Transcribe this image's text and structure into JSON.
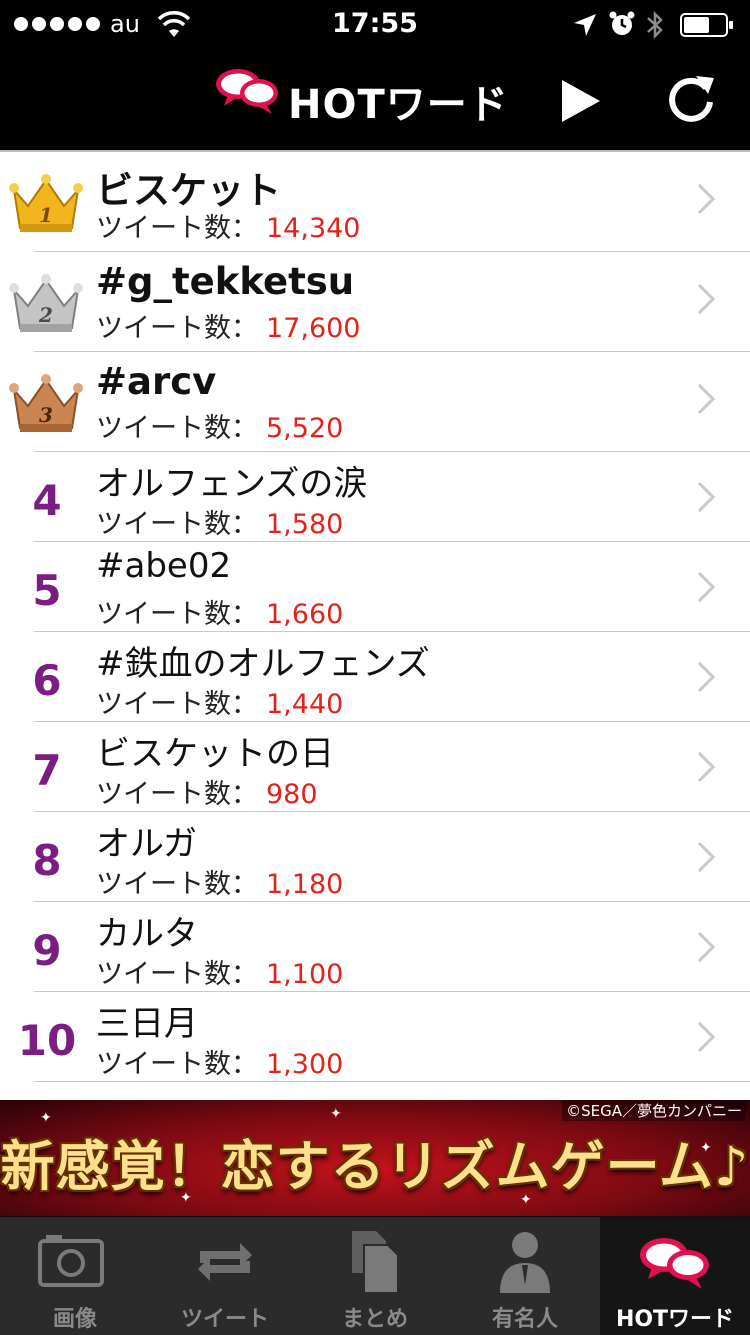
{
  "status_bar": {
    "carrier": "au",
    "time": "17:55",
    "icons": [
      "signal-dots",
      "wifi-icon",
      "location-arrow-icon",
      "alarm-icon",
      "bluetooth-icon",
      "battery-icon"
    ]
  },
  "nav": {
    "title": "HOTワード",
    "logo_icon": "speech-bubbles-icon",
    "play_icon": "play-icon",
    "refresh_icon": "refresh-icon",
    "accent": "#e0114f"
  },
  "ranking": [
    {
      "rank": "1",
      "crown": "gold",
      "word": "ビスケット",
      "count_label": "ツイート数：",
      "count": "14,340"
    },
    {
      "rank": "2",
      "crown": "silver",
      "word": "#g_tekketsu",
      "count_label": "ツイート数：",
      "count": "17,600"
    },
    {
      "rank": "3",
      "crown": "bronze",
      "word": "#arcv",
      "count_label": "ツイート数：",
      "count": "5,520"
    },
    {
      "rank": "4",
      "word": "オルフェンズの涙",
      "count_label": "ツイート数：",
      "count": "1,580"
    },
    {
      "rank": "5",
      "word": "#abe02",
      "count_label": "ツイート数：",
      "count": "1,660"
    },
    {
      "rank": "6",
      "word": "#鉄血のオルフェンズ",
      "count_label": "ツイート数：",
      "count": "1,440"
    },
    {
      "rank": "7",
      "word": "ビスケットの日",
      "count_label": "ツイート数：",
      "count": "980"
    },
    {
      "rank": "8",
      "word": "オルガ",
      "count_label": "ツイート数：",
      "count": "1,180"
    },
    {
      "rank": "9",
      "word": "カルタ",
      "count_label": "ツイート数：",
      "count": "1,100"
    },
    {
      "rank": "10",
      "word": "三日月",
      "count_label": "ツイート数：",
      "count": "1,300"
    }
  ],
  "colors": {
    "rank_number": "#7b1e84",
    "count_value": "#e2231a",
    "gold": "#f2b51c",
    "silver": "#b9b9b9",
    "bronze": "#c98552"
  },
  "ad": {
    "copyright": "©SEGA／夢色カンパニー",
    "headline": "新感覚！恋するリズムゲーム♪"
  },
  "tabs": [
    {
      "label": "画像",
      "icon": "camera-icon",
      "active": false
    },
    {
      "label": "ツイート",
      "icon": "retweet-icon",
      "active": false
    },
    {
      "label": "まとめ",
      "icon": "documents-icon",
      "active": false
    },
    {
      "label": "有名人",
      "icon": "person-icon",
      "active": false
    },
    {
      "label": "HOTワード",
      "icon": "speech-bubbles-icon",
      "active": true
    }
  ]
}
